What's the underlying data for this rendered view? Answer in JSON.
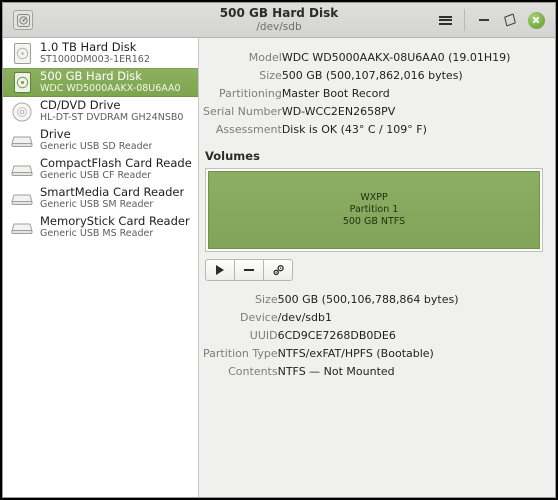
{
  "window": {
    "app_icon": "disk-utility-icon",
    "title": "500 GB Hard Disk",
    "subtitle": "/dev/sdb",
    "menu_icon": "hamburger-menu-icon",
    "minimize_icon": "minimize-icon",
    "maximize_icon": "maximize-icon",
    "close_icon": "close-icon",
    "accent_green": "#7da54f",
    "close_green": "#74aa3f"
  },
  "sidebar": {
    "items": [
      {
        "title": "1.0 TB Hard Disk",
        "subtitle": "ST1000DM003-1ER162",
        "icon": "hard-disk-icon",
        "selected": false
      },
      {
        "title": "500 GB Hard Disk",
        "subtitle": "WDC WD5000AAKX-08U6AA0",
        "icon": "hard-disk-icon",
        "selected": true
      },
      {
        "title": "CD/DVD Drive",
        "subtitle": "HL-DT-ST DVDRAM GH24NSB0",
        "icon": "optical-disc-icon",
        "selected": false
      },
      {
        "title": "Drive",
        "subtitle": "Generic USB SD Reader",
        "icon": "card-reader-icon",
        "selected": false
      },
      {
        "title": "CompactFlash Card Reader",
        "subtitle": "Generic USB CF Reader",
        "icon": "card-reader-icon",
        "selected": false
      },
      {
        "title": "SmartMedia Card Reader",
        "subtitle": "Generic USB SM Reader",
        "icon": "card-reader-icon",
        "selected": false
      },
      {
        "title": "MemoryStick Card Reader",
        "subtitle": "Generic USB MS Reader",
        "icon": "card-reader-icon",
        "selected": false
      }
    ]
  },
  "drive": {
    "rows": [
      {
        "label": "Model",
        "value": "WDC WD5000AAKX-08U6AA0 (19.01H19)"
      },
      {
        "label": "Size",
        "value": "500 GB (500,107,862,016 bytes)"
      },
      {
        "label": "Partitioning",
        "value": "Master Boot Record"
      },
      {
        "label": "Serial Number",
        "value": "WD-WCC2EN2658PV"
      },
      {
        "label": "Assessment",
        "value": "Disk is OK (43° C / 109° F)"
      }
    ]
  },
  "volumes": {
    "heading": "Volumes",
    "partition": {
      "name": "WXPP",
      "number": "Partition 1",
      "size_fs": "500 GB NTFS",
      "color": "#85a95e"
    },
    "toolbar": {
      "mount_label": "mount-volume",
      "delete_label": "delete-volume",
      "options_label": "more-options"
    },
    "rows": [
      {
        "label": "Size",
        "value": "500 GB (500,106,788,864 bytes)"
      },
      {
        "label": "Device",
        "value": "/dev/sdb1"
      },
      {
        "label": "UUID",
        "value": "6CD9CE7268DB0DE6"
      },
      {
        "label": "Partition Type",
        "value": "NTFS/exFAT/HPFS (Bootable)"
      },
      {
        "label": "Contents",
        "value": "NTFS — Not Mounted"
      }
    ]
  }
}
